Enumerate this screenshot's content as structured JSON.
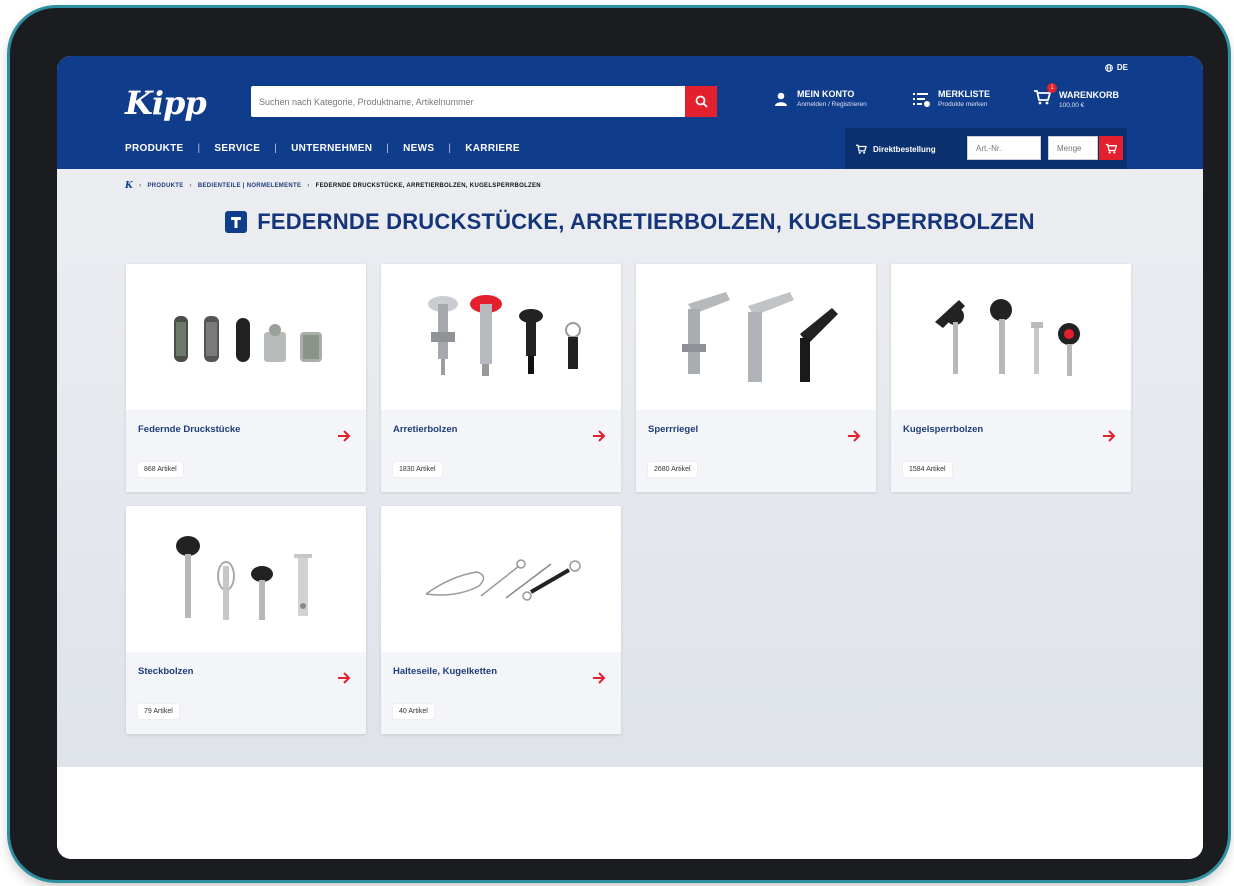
{
  "header": {
    "logo": "Kipp",
    "language": "DE",
    "search_placeholder": "Suchen nach Kategorie, Produktname, Artikelnummer",
    "account_title": "MEIN KONTO",
    "account_sub": "Anmelden / Registrieren",
    "watchlist_title": "MERKLISTE",
    "watchlist_sub": "Produkte merken",
    "cart_title": "WARENKORB",
    "cart_sub": "100,00 €",
    "cart_count": "1"
  },
  "nav": {
    "items": [
      "PRODUKTE",
      "SERVICE",
      "UNTERNEHMEN",
      "NEWS",
      "KARRIERE"
    ],
    "direct_order_label": "Direktbestellung",
    "art_placeholder": "Art.-Nr.",
    "qty_placeholder": "Menge"
  },
  "breadcrumb": [
    "PRODUKTE",
    "BEDIENTEILE | NORMELEMENTE",
    "FEDERNDE DRUCKSTÜCKE, ARRETIERBOLZEN, KUGELSPERRBOLZEN"
  ],
  "page_title": "FEDERNDE DRUCKSTÜCKE, ARRETIERBOLZEN, KUGELSPERRBOLZEN",
  "categories": [
    {
      "name": "Federnde Druckstücke",
      "count": "868 Artikel",
      "icon": "spring-plunger-image"
    },
    {
      "name": "Arretierbolzen",
      "count": "1830 Artikel",
      "icon": "indexing-plunger-image"
    },
    {
      "name": "Sperrriegel",
      "count": "2680 Artikel",
      "icon": "cam-action-indexing-image"
    },
    {
      "name": "Kugelsperrbolzen",
      "count": "1584 Artikel",
      "icon": "ball-lock-pin-image"
    },
    {
      "name": "Steckbolzen",
      "count": "79 Artikel",
      "icon": "locking-pin-image"
    },
    {
      "name": "Halteseile, Kugelketten",
      "count": "40 Artikel",
      "icon": "retaining-cable-image"
    }
  ],
  "colors": {
    "brand_blue": "#103c8c",
    "accent_red": "#e3202d",
    "title_blue": "#15357b"
  }
}
